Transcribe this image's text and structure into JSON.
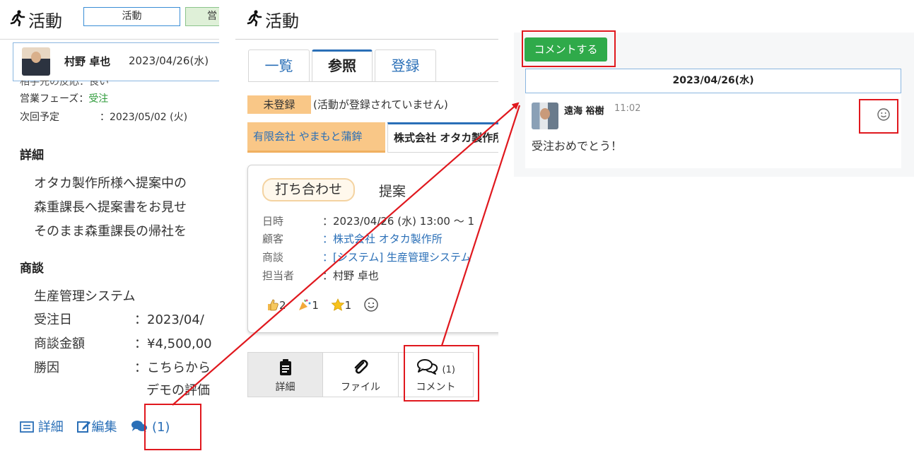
{
  "panel1": {
    "app_title": "活動",
    "tab_activity": "活動",
    "tab_business": "営",
    "user_name": "村野 卓也",
    "user_date": "2023/04/26(水)",
    "cut_line": "相手先の反応：良い",
    "phase_label": "営業フェーズ",
    "phase_sep": "：",
    "phase_value": "受注",
    "next_label": "次回予定",
    "next_value": "：2023/05/02 (火)",
    "detail_heading": "詳細",
    "detail_lines": [
      "オタカ製作所様へ提案中の",
      "森重課長へ提案書をお見せ",
      "そのまま森重課長の帰社を"
    ],
    "deal_heading": "商談",
    "deal_name": "生産管理システム",
    "deal_rows": [
      {
        "label": "受注日",
        "value": "：2023/04/"
      },
      {
        "label": "商談金額",
        "value": "：¥4,500,00"
      },
      {
        "label": "勝因",
        "value": "：こちらから"
      }
    ],
    "deal_extra": "デモの評価",
    "footer": {
      "detail": "詳細",
      "edit": "編集",
      "comment": "(1)"
    }
  },
  "panel2": {
    "app_title": "活動",
    "tabs": [
      "一覧",
      "参照",
      "登録"
    ],
    "unreg_badge": "未登録",
    "unreg_msg": "(活動が登録されていません)",
    "cust_tab1": "有限会社 やまもと蒲鉾",
    "cust_tab2": "株式会社 オタカ製作所",
    "meeting_type": "打ち合わせ",
    "meeting_kind": "提案",
    "fields": [
      {
        "label": "日時",
        "value": "：2023/04/26 (水) 13:00 ～ 1"
      },
      {
        "label": "顧客",
        "value": "：株式会社 オタカ製作所"
      },
      {
        "label": "商談",
        "value": "：[システム] 生産管理システム"
      },
      {
        "label": "担当者",
        "value": "：村野 卓也"
      }
    ],
    "reactions": {
      "thumbs": "2",
      "party": "1",
      "star": "1"
    },
    "bottom_tabs": {
      "detail": "詳細",
      "file": "ファイル",
      "comment": "コメント",
      "comment_count": "(1)"
    }
  },
  "panel3": {
    "comment_button": "コメントする",
    "date": "2023/04/26(水)",
    "commenter": "遠海 裕樹",
    "time": "11:02",
    "body": "受注おめでとう！"
  },
  "colors": {
    "accent": "#2a6fb7",
    "highlight": "#e0181e",
    "green_button": "#2faa4a",
    "orange_badge": "#f9c787"
  }
}
